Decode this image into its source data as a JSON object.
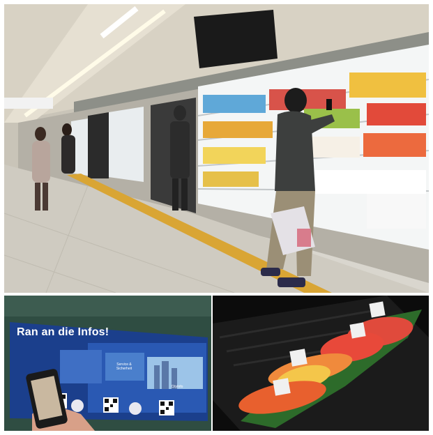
{
  "panels": {
    "top": {
      "scene": "subway platform with virtual grocery store wall"
    },
    "bottom_left": {
      "poster_title": "Ran an die Infos!",
      "chips": [
        "Service & Sicherheit",
        "CityInfo"
      ]
    },
    "bottom_right": {
      "scene": "sushi plate with QR code tags"
    }
  },
  "colors": {
    "poster_blue": "#1b3f8c",
    "sushi_tuna": "#e8493a",
    "shelf_white": "#f4f6f6"
  }
}
